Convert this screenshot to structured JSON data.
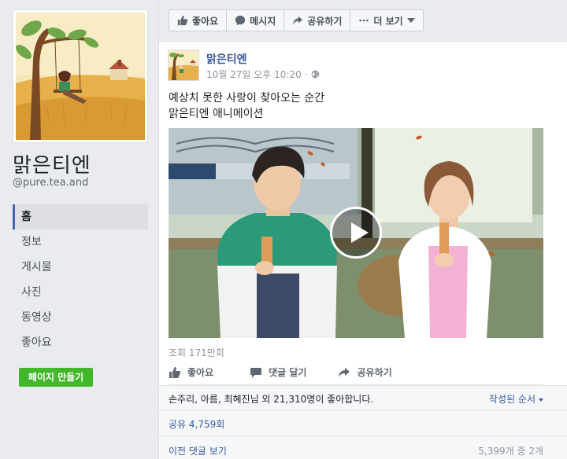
{
  "page": {
    "name": "맑은티엔",
    "handle": "@pure.tea.and"
  },
  "nav": {
    "items": [
      {
        "label": "홈"
      },
      {
        "label": "정보"
      },
      {
        "label": "게시물"
      },
      {
        "label": "사진"
      },
      {
        "label": "동영상"
      },
      {
        "label": "좋아요"
      }
    ],
    "active_index": 0
  },
  "create_page_label": "페이지 만들기",
  "action_bar": {
    "like": "좋아요",
    "message": "메시지",
    "share": "공유하기",
    "more": "더 보기"
  },
  "post": {
    "author": "맑은티엔",
    "timestamp": "10월 27일 오후 10:20 · ",
    "text_line1": "예상치 못한 사랑이 찾아오는 순간",
    "text_line2": "맑은티엔 애니메이션",
    "views": "조회 171만회",
    "actions": {
      "like": "좋아요",
      "comment": "댓글 달기",
      "share": "공유하기"
    },
    "likes_summary": "손주리, 아름, 최혜진님 외 21,310명이 좋아합니다.",
    "order_label": "작성된 순서",
    "shares": "공유 4,759회",
    "prev_comments": "이전 댓글 보기",
    "comment_count": "5,399개 중 2개"
  },
  "colors": {
    "link": "#365899",
    "accent": "#4267b2",
    "create_button": "#42b72a",
    "background": "#e9ebee"
  },
  "icons": {
    "like": "thumbs-up-icon",
    "message": "chat-bubble-icon",
    "share": "share-arrow-icon",
    "more": "ellipsis-icon",
    "comment": "comment-icon",
    "privacy": "globe-icon",
    "video": "play-icon"
  }
}
